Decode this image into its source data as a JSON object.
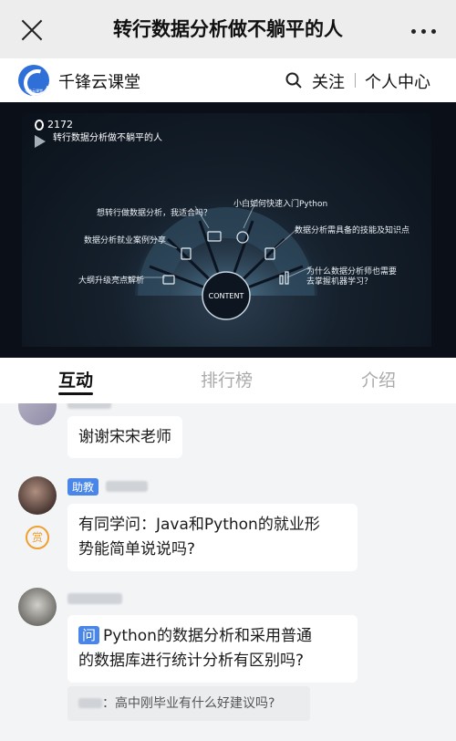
{
  "nav": {
    "title": "转行数据分析做不躺平的人"
  },
  "channel": {
    "name": "千锋云课堂",
    "logo_text": "千锋云课堂",
    "follow_label": "关注",
    "profile_label": "个人中心"
  },
  "video": {
    "viewer_count": "2172",
    "slide_title": "转行数据分析做不躺平的人",
    "center_label": "CONTENT",
    "topics": [
      "想转行做数据分析，我适合吗？",
      "小白如何快速入门Python",
      "数据分析就业案例分享",
      "数据分析需具备的技能及知识点",
      "大纲升级亮点解析",
      "为什么数据分析师也需要",
      "去掌握机器学习？"
    ]
  },
  "tabs": [
    {
      "label": "互动"
    },
    {
      "label": "排行榜"
    },
    {
      "label": "介绍"
    }
  ],
  "chat": {
    "messages": [
      {
        "text": "谢谢宋宋老师"
      },
      {
        "badge": "助教",
        "reward_label": "赏",
        "text": "有同学问：Java和Python的就业形势能简单说说吗?",
        "line1": "有同学问：Java和Python的就业形",
        "line2": "势能简单说说吗?"
      },
      {
        "q_label": "问",
        "line1": "Python的数据分析和采用普通",
        "line2": "的数据库进行统计分析有区别吗?",
        "quote": "：高中刚毕业有什么好建议吗?"
      }
    ]
  },
  "colors": {
    "accent": "#4a86e8",
    "reward": "#f0a030",
    "brand": "#2f6fd8"
  }
}
